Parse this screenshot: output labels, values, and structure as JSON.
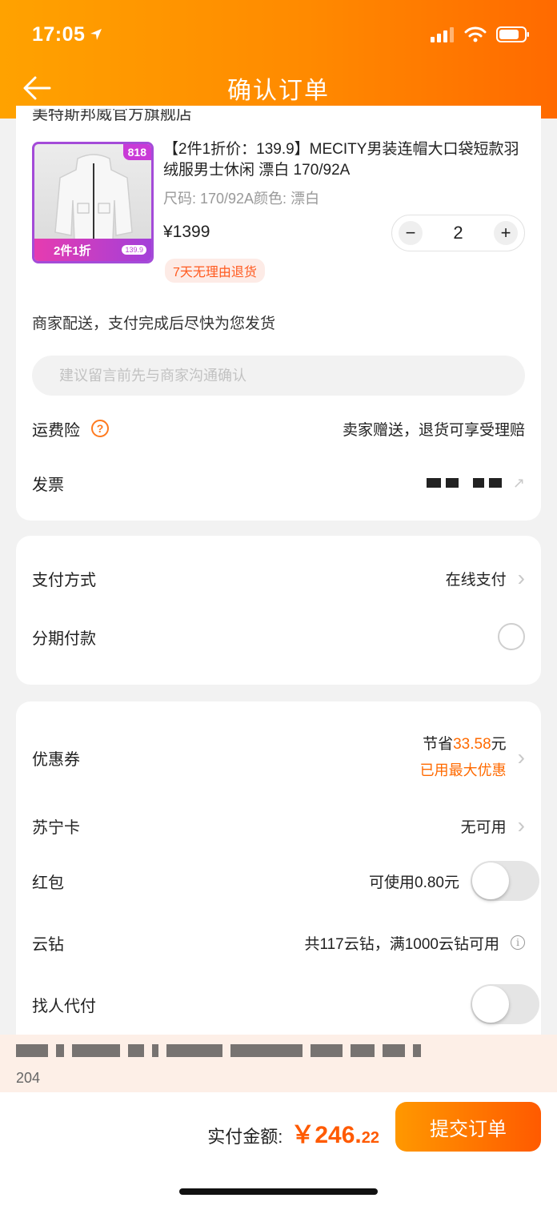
{
  "status": {
    "time": "17:05"
  },
  "nav": {
    "title": "确认订单"
  },
  "store": {
    "name": "美特斯邦威官方旗舰店"
  },
  "product": {
    "thumb_tag": "818",
    "thumb_promo": "2件1折",
    "thumb_price": "139.9",
    "name": "【2件1折价：139.9】MECITY男装连帽大口袋短款羽绒服男士休闲 漂白 170/92A",
    "spec": "尺码: 170/92A颜色: 漂白",
    "price": "¥1399",
    "quantity": "2",
    "minus": "−",
    "plus": "+",
    "return_badge": "7天无理由退货"
  },
  "delivery": {
    "text": "商家配送，支付完成后尽快为您发货"
  },
  "message": {
    "placeholder": "建议留言前先与商家沟通确认"
  },
  "freight": {
    "label": "运费险",
    "value": "卖家赠送，退货可享受理赔"
  },
  "invoice": {
    "label": "发票"
  },
  "payment": {
    "label": "支付方式",
    "value": "在线支付"
  },
  "installment": {
    "label": "分期付款"
  },
  "coupon": {
    "label": "优惠券",
    "save_prefix": "节省",
    "save_amount": "33.58",
    "save_suffix": "元",
    "note": "已用最大优惠"
  },
  "suning_card": {
    "label": "苏宁卡",
    "value": "无可用"
  },
  "red_packet": {
    "label": "红包",
    "value": "可使用0.80元"
  },
  "yunzuan": {
    "label": "云钻",
    "value": "共117云钻，满1000云钻可用"
  },
  "proxy_pay": {
    "label": "找人代付"
  },
  "notice": {
    "number": "204"
  },
  "footer": {
    "total_label": "实付金额:",
    "currency": "￥",
    "total_int": "246.",
    "total_dec": "22",
    "submit_label": "提交订单"
  },
  "colors": {
    "accent": "#ff6a00",
    "header_start": "#ffa200",
    "header_end": "#ff6a00"
  }
}
